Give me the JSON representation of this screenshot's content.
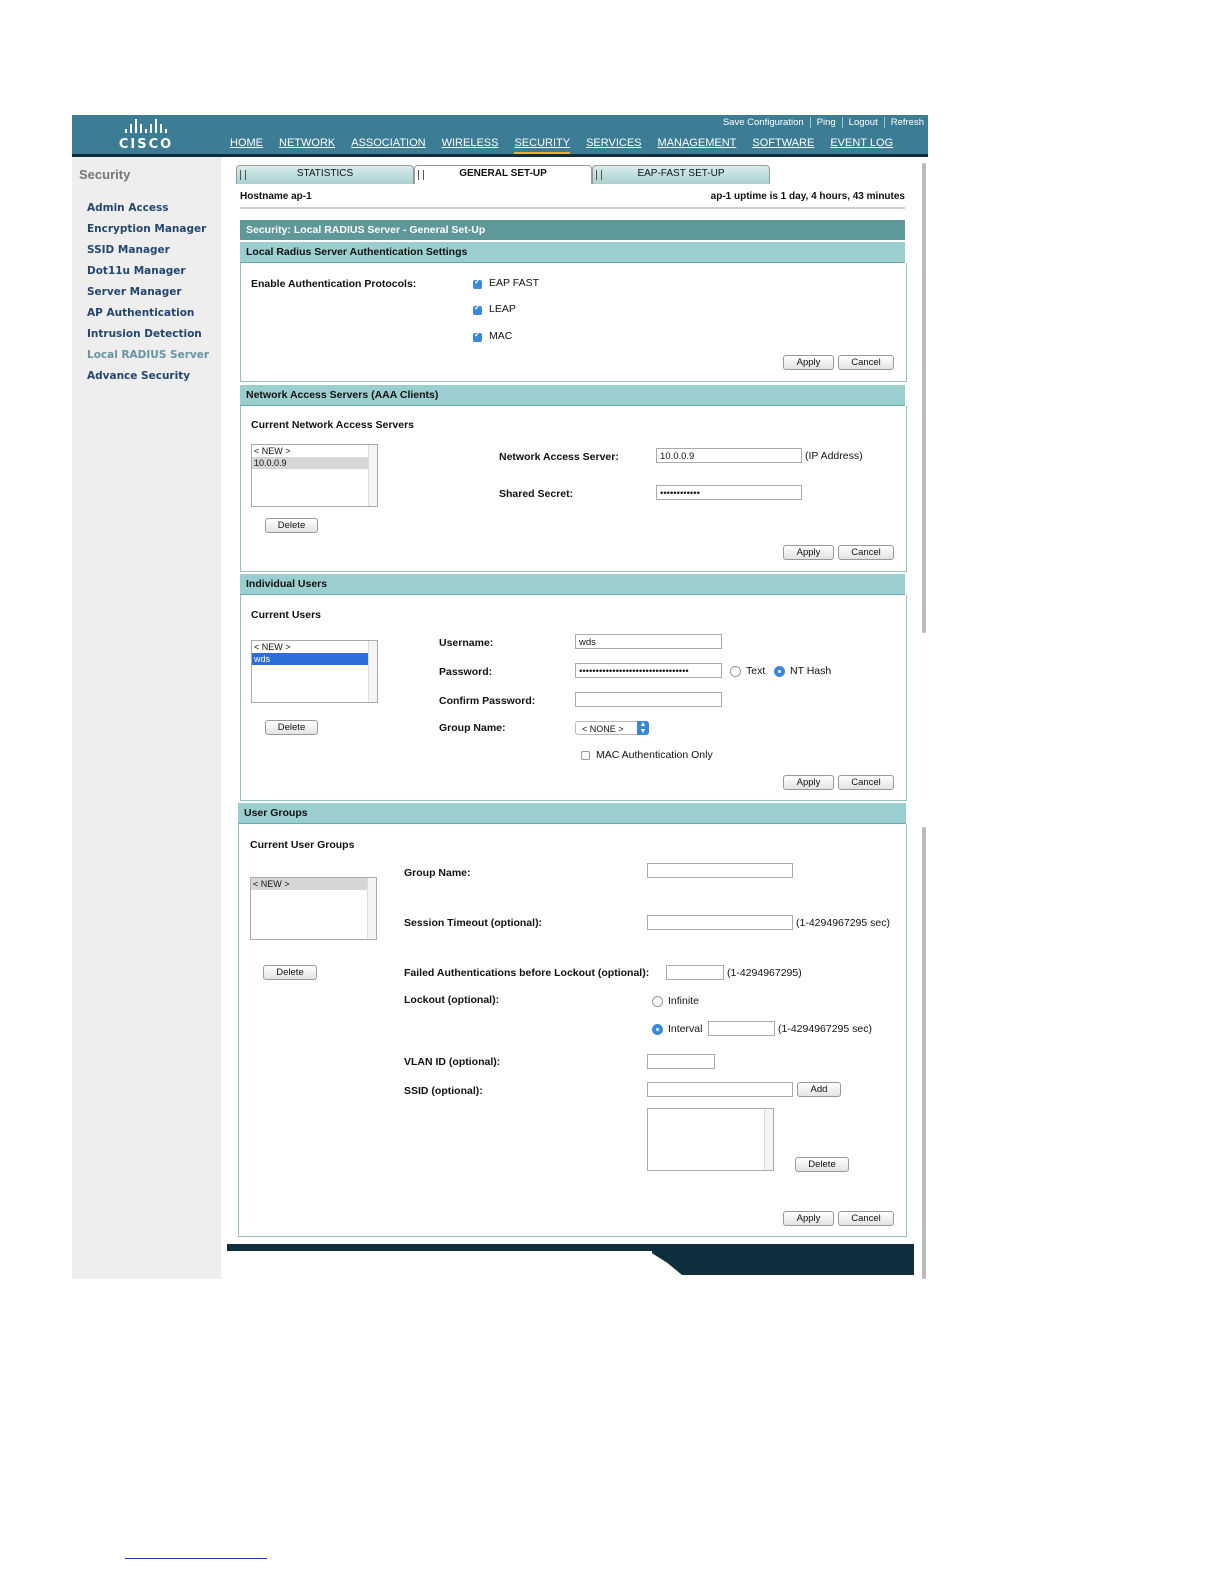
{
  "header": {
    "logo_text": "CISCO",
    "top_links": [
      "Save Configuration",
      "Ping",
      "Logout",
      "Refresh"
    ],
    "nav": [
      "HOME",
      "NETWORK",
      "ASSOCIATION",
      "WIRELESS",
      "SECURITY",
      "SERVICES",
      "MANAGEMENT",
      "SOFTWARE",
      "EVENT LOG"
    ],
    "active_nav": "SECURITY"
  },
  "sidebar": {
    "title": "Security",
    "items": [
      "Admin Access",
      "Encryption Manager",
      "SSID Manager",
      "Dot11u Manager",
      "Server Manager",
      "AP Authentication",
      "Intrusion Detection",
      "Local RADIUS Server",
      "Advance Security"
    ],
    "active_item": "Local RADIUS Server"
  },
  "tabs": [
    "STATISTICS",
    "GENERAL SET-UP",
    "EAP-FAST SET-UP"
  ],
  "active_tab": "GENERAL SET-UP",
  "hostline": {
    "hostname": "Hostname  ap-1",
    "uptime": "ap-1 uptime is 1 day, 4 hours, 43 minutes"
  },
  "page_title": "Security: Local RADIUS Server - General Set-Up",
  "auth_settings": {
    "heading": "Local Radius Server Authentication Settings",
    "label": "Enable Authentication Protocols:",
    "protocols": [
      {
        "name": "EAP FAST",
        "checked": true
      },
      {
        "name": "LEAP",
        "checked": true
      },
      {
        "name": "MAC",
        "checked": true
      }
    ]
  },
  "nas": {
    "heading": "Network Access Servers (AAA Clients)",
    "current_label": "Current Network Access Servers",
    "list": [
      "< NEW >",
      "10.0.0.9"
    ],
    "selected": "10.0.0.9",
    "server_label": "Network Access Server:",
    "server_value": "10.0.0.9",
    "server_hint": "(IP Address)",
    "secret_label": "Shared Secret:",
    "secret_value": "••••••••••••"
  },
  "users": {
    "heading": "Individual Users",
    "current_label": "Current Users",
    "list": [
      "< NEW >",
      "wds"
    ],
    "selected": "wds",
    "username_label": "Username:",
    "username_value": "wds",
    "password_label": "Password:",
    "password_value": "•••••••••••••••••••••••••••••••••",
    "password_types": [
      {
        "name": "Text",
        "selected": false
      },
      {
        "name": "NT Hash",
        "selected": true
      }
    ],
    "confirm_label": "Confirm Password:",
    "confirm_value": "",
    "group_label": "Group Name:",
    "group_value": "< NONE >",
    "mac_only_label": "MAC Authentication Only",
    "mac_only_checked": false
  },
  "groups": {
    "heading": "User Groups",
    "current_label": "Current User Groups",
    "list": [
      "< NEW >"
    ],
    "group_name_label": "Group Name:",
    "session_timeout_label": "Session Timeout (optional):",
    "session_timeout_hint": "(1-4294967295 sec)",
    "failed_auth_label": "Failed Authentications before Lockout (optional):",
    "failed_auth_hint": "(1-4294967295)",
    "lockout_label": "Lockout (optional):",
    "lockout_options": [
      {
        "name": "Infinite",
        "selected": false
      },
      {
        "name": "Interval",
        "selected": true
      }
    ],
    "interval_hint": "(1-4294967295 sec)",
    "vlan_label": "VLAN ID (optional):",
    "ssid_label": "SSID (optional):",
    "add_label": "Add"
  },
  "buttons": {
    "apply": "Apply",
    "cancel": "Cancel",
    "delete": "Delete"
  },
  "colors": {
    "header_bg": "#3d7c95",
    "bar_dark": "#5f9898",
    "bar_light": "#9bcfcf",
    "accent": "#e9b23a",
    "sidebar_link": "#24466f"
  }
}
